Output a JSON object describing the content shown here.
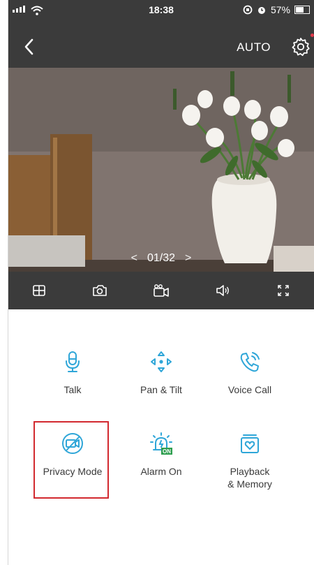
{
  "status_bar": {
    "time": "18:38",
    "battery_percent": "57%",
    "battery_level": 0.57
  },
  "header": {
    "mode_label": "AUTO"
  },
  "video": {
    "pager_text": "01/32",
    "prev_symbol": "<",
    "next_symbol": ">"
  },
  "toolbar": {
    "items": [
      "grid-view-icon",
      "snapshot-icon",
      "record-icon",
      "volume-icon",
      "fullscreen-icon"
    ]
  },
  "features": [
    {
      "label": "Talk",
      "icon": "microphone-icon"
    },
    {
      "label": "Pan & Tilt",
      "icon": "pan-tilt-icon"
    },
    {
      "label": "Voice Call",
      "icon": "phone-call-icon"
    },
    {
      "label": "Privacy Mode",
      "icon": "privacy-camera-off-icon"
    },
    {
      "label": "Alarm On",
      "icon": "alarm-on-icon",
      "badge": "ON"
    },
    {
      "label": "Playback\n& Memory",
      "icon": "playback-memory-icon"
    }
  ],
  "colors": {
    "accent": "#2fa6d8",
    "topbar": "#3b3b3b",
    "highlight": "#d2292f",
    "alarm_badge": "#2e9e4f"
  }
}
